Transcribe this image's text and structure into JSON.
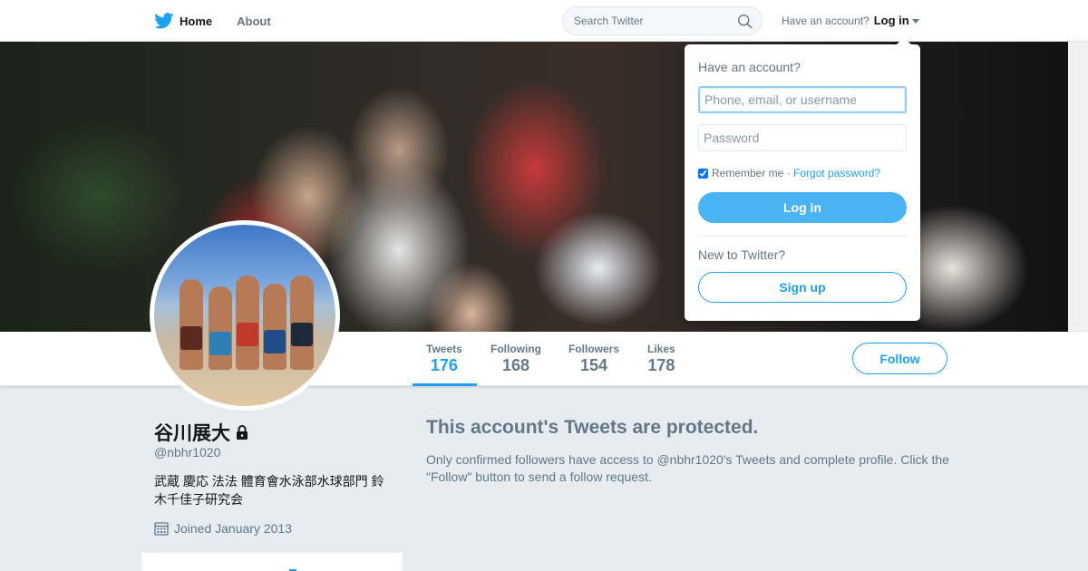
{
  "topbar": {
    "home_label": "Home",
    "about_label": "About",
    "search_placeholder": "Search Twitter",
    "have_account": "Have an account?",
    "login_label": "Log in",
    "icons": {
      "logo": "twitter-bird-icon",
      "search": "search-icon",
      "caret": "caret-down-icon"
    }
  },
  "profile": {
    "name": "谷川展大",
    "screen_name": "@nbhr1020",
    "bio": "武蔵 慶応 法法 體育會水泳部水球部門 鈴木千佳子研究会",
    "joined": "Joined January 2013",
    "protected": true
  },
  "stats": [
    {
      "label": "Tweets",
      "value": "176",
      "active": true
    },
    {
      "label": "Following",
      "value": "168",
      "active": false
    },
    {
      "label": "Followers",
      "value": "154",
      "active": false
    },
    {
      "label": "Likes",
      "value": "178",
      "active": false
    }
  ],
  "follow_button": "Follow",
  "protected_notice": {
    "title": "This account's Tweets are protected.",
    "text": "Only confirmed followers have access to @nbhr1020's Tweets and complete profile. Click the \"Follow\" button to send a follow request."
  },
  "login_dropdown": {
    "heading": "Have an account?",
    "username_placeholder": "Phone, email, or username",
    "password_placeholder": "Password",
    "remember_label": "Remember me",
    "separator": " · ",
    "forgot_label": "Forgot password?",
    "login_button": "Log in",
    "new_label": "New to Twitter?",
    "signup_button": "Sign up",
    "remember_checked": true
  },
  "colors": {
    "accent": "#1da1f2",
    "login_button_bg": "#4ab3f4",
    "background": "#e6ecf0",
    "muted_text": "#657786"
  }
}
